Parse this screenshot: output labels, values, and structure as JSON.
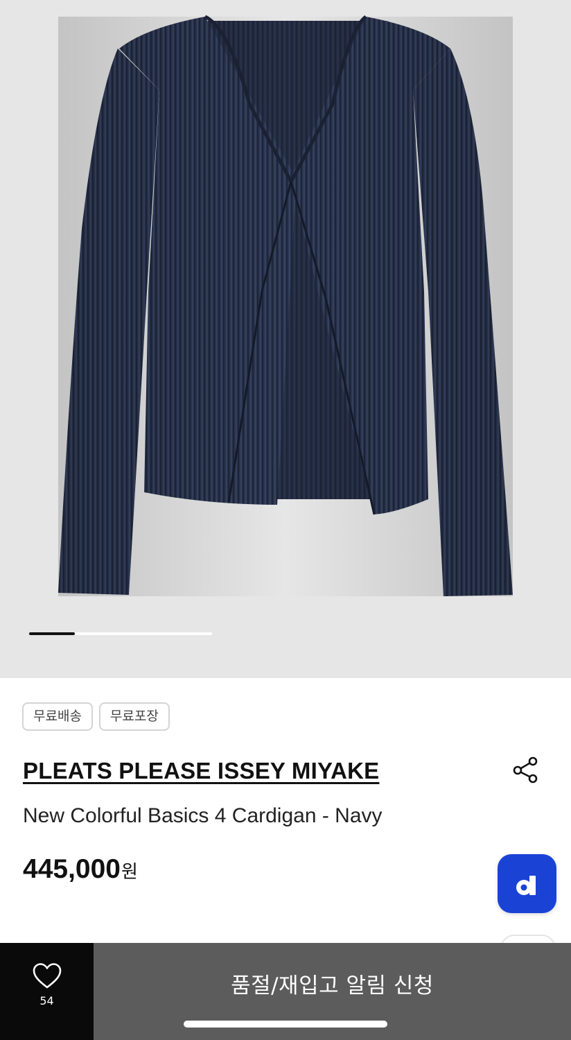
{
  "gallery": {
    "image_alt": "product-photo-cardigan",
    "slide_progress": 0.25,
    "background_color": "#e6e6e6",
    "garment_color": "#2b3550"
  },
  "tags": [
    "무료배송",
    "무료포장"
  ],
  "product": {
    "brand": "PLEATS PLEASE ISSEY MIYAKE",
    "name": "New Colorful Basics 4 Cardigan - Navy",
    "price_amount": "445,000",
    "price_unit": "원"
  },
  "icons": {
    "share": "share-icon",
    "fab": "d-logo-icon",
    "like": "heart-icon"
  },
  "fab_letter": "d",
  "bottom_bar": {
    "like_count": "54",
    "restock_label": "품절/재입고 알림 신청"
  },
  "colors": {
    "fab": "#1a43d6",
    "like_bg": "#0a0a0a",
    "restock_bg": "#5c5c5c"
  }
}
